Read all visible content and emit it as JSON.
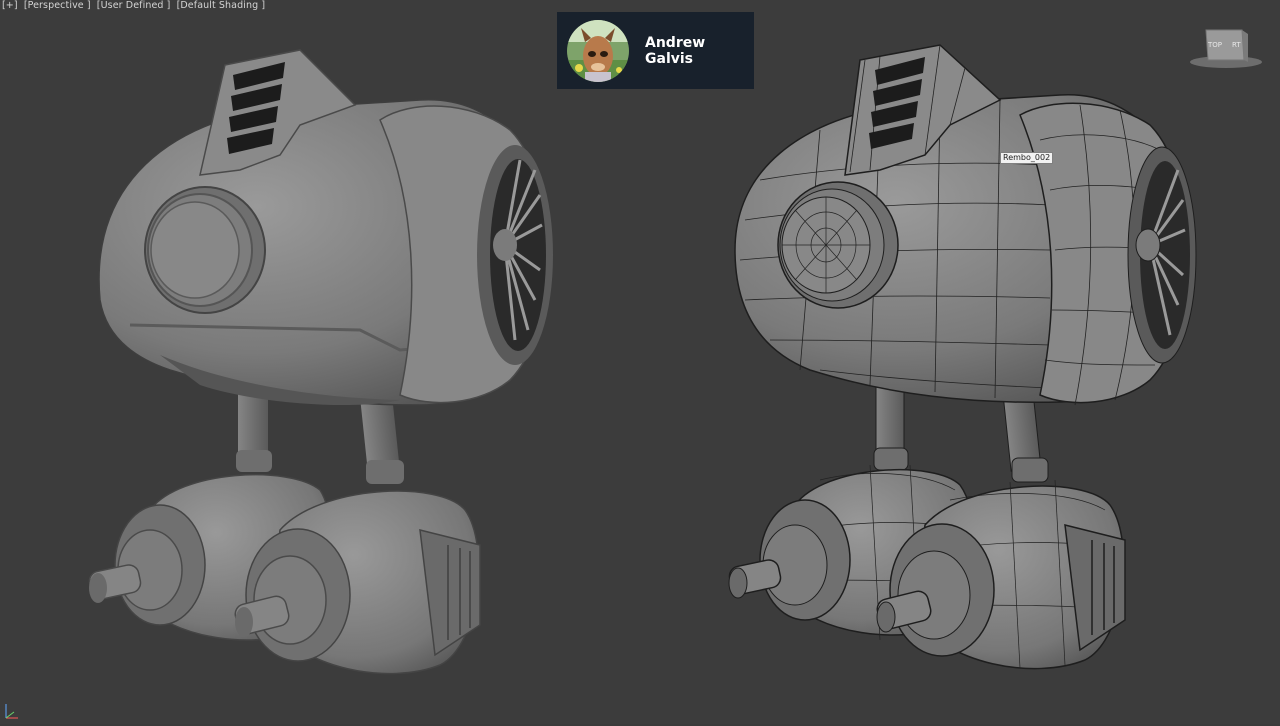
{
  "viewport": {
    "labels": [
      "[+]",
      "[Perspective ]",
      "[User Defined ]",
      "[Default Shading ]"
    ],
    "background": "#3c3c3c",
    "object_tag": "Rembo_002",
    "viewcube_faces": [
      "TOP",
      "RT"
    ]
  },
  "user_card": {
    "name": "Andrew Galvis",
    "background": "#18212c"
  },
  "icons": {
    "viewcube": "viewcube-icon",
    "axis": "axis-tripod-icon",
    "avatar": "avatar-photo"
  },
  "colors": {
    "model_light": "#8a8a8a",
    "model_shadow": "#4a4a4a",
    "wire": "#1e1e1e"
  }
}
